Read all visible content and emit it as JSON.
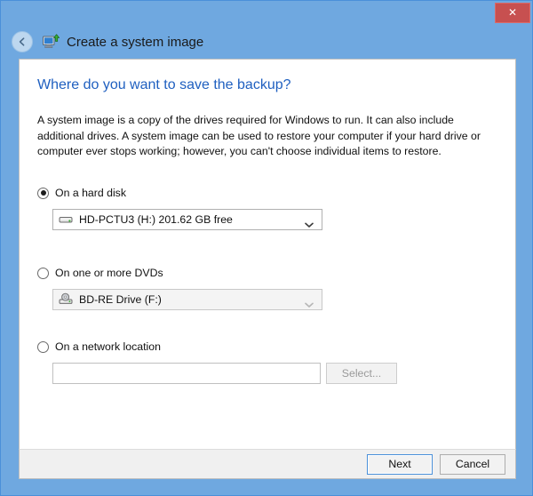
{
  "window": {
    "title": "Create a system image",
    "app_icon": "system-image-icon",
    "back_icon": "back-arrow-icon",
    "close_label": "✕",
    "accent_color": "#6fa8e0",
    "close_color": "#c75050"
  },
  "page": {
    "heading": "Where do you want to save the backup?",
    "heading_color": "#2060c0",
    "description": "A system image is a copy of the drives required for Windows to run. It can also include additional drives. A system image can be used to restore your computer if your hard drive or computer ever stops working; however, you can't choose individual items to restore."
  },
  "options": {
    "hard_disk": {
      "label": "On a hard disk",
      "selected": true,
      "combo_value": "HD-PCTU3 (H:)  201.62 GB free",
      "combo_icon": "external-hard-drive-icon",
      "enabled": true
    },
    "dvd": {
      "label": "On one or more DVDs",
      "selected": false,
      "combo_value": "BD-RE Drive (F:)",
      "combo_icon": "optical-drive-icon",
      "enabled": false
    },
    "network": {
      "label": "On a network location",
      "selected": false,
      "input_value": "",
      "input_placeholder": "",
      "select_label": "Select...",
      "enabled": false
    }
  },
  "footer": {
    "next_label": "Next",
    "cancel_label": "Cancel"
  }
}
